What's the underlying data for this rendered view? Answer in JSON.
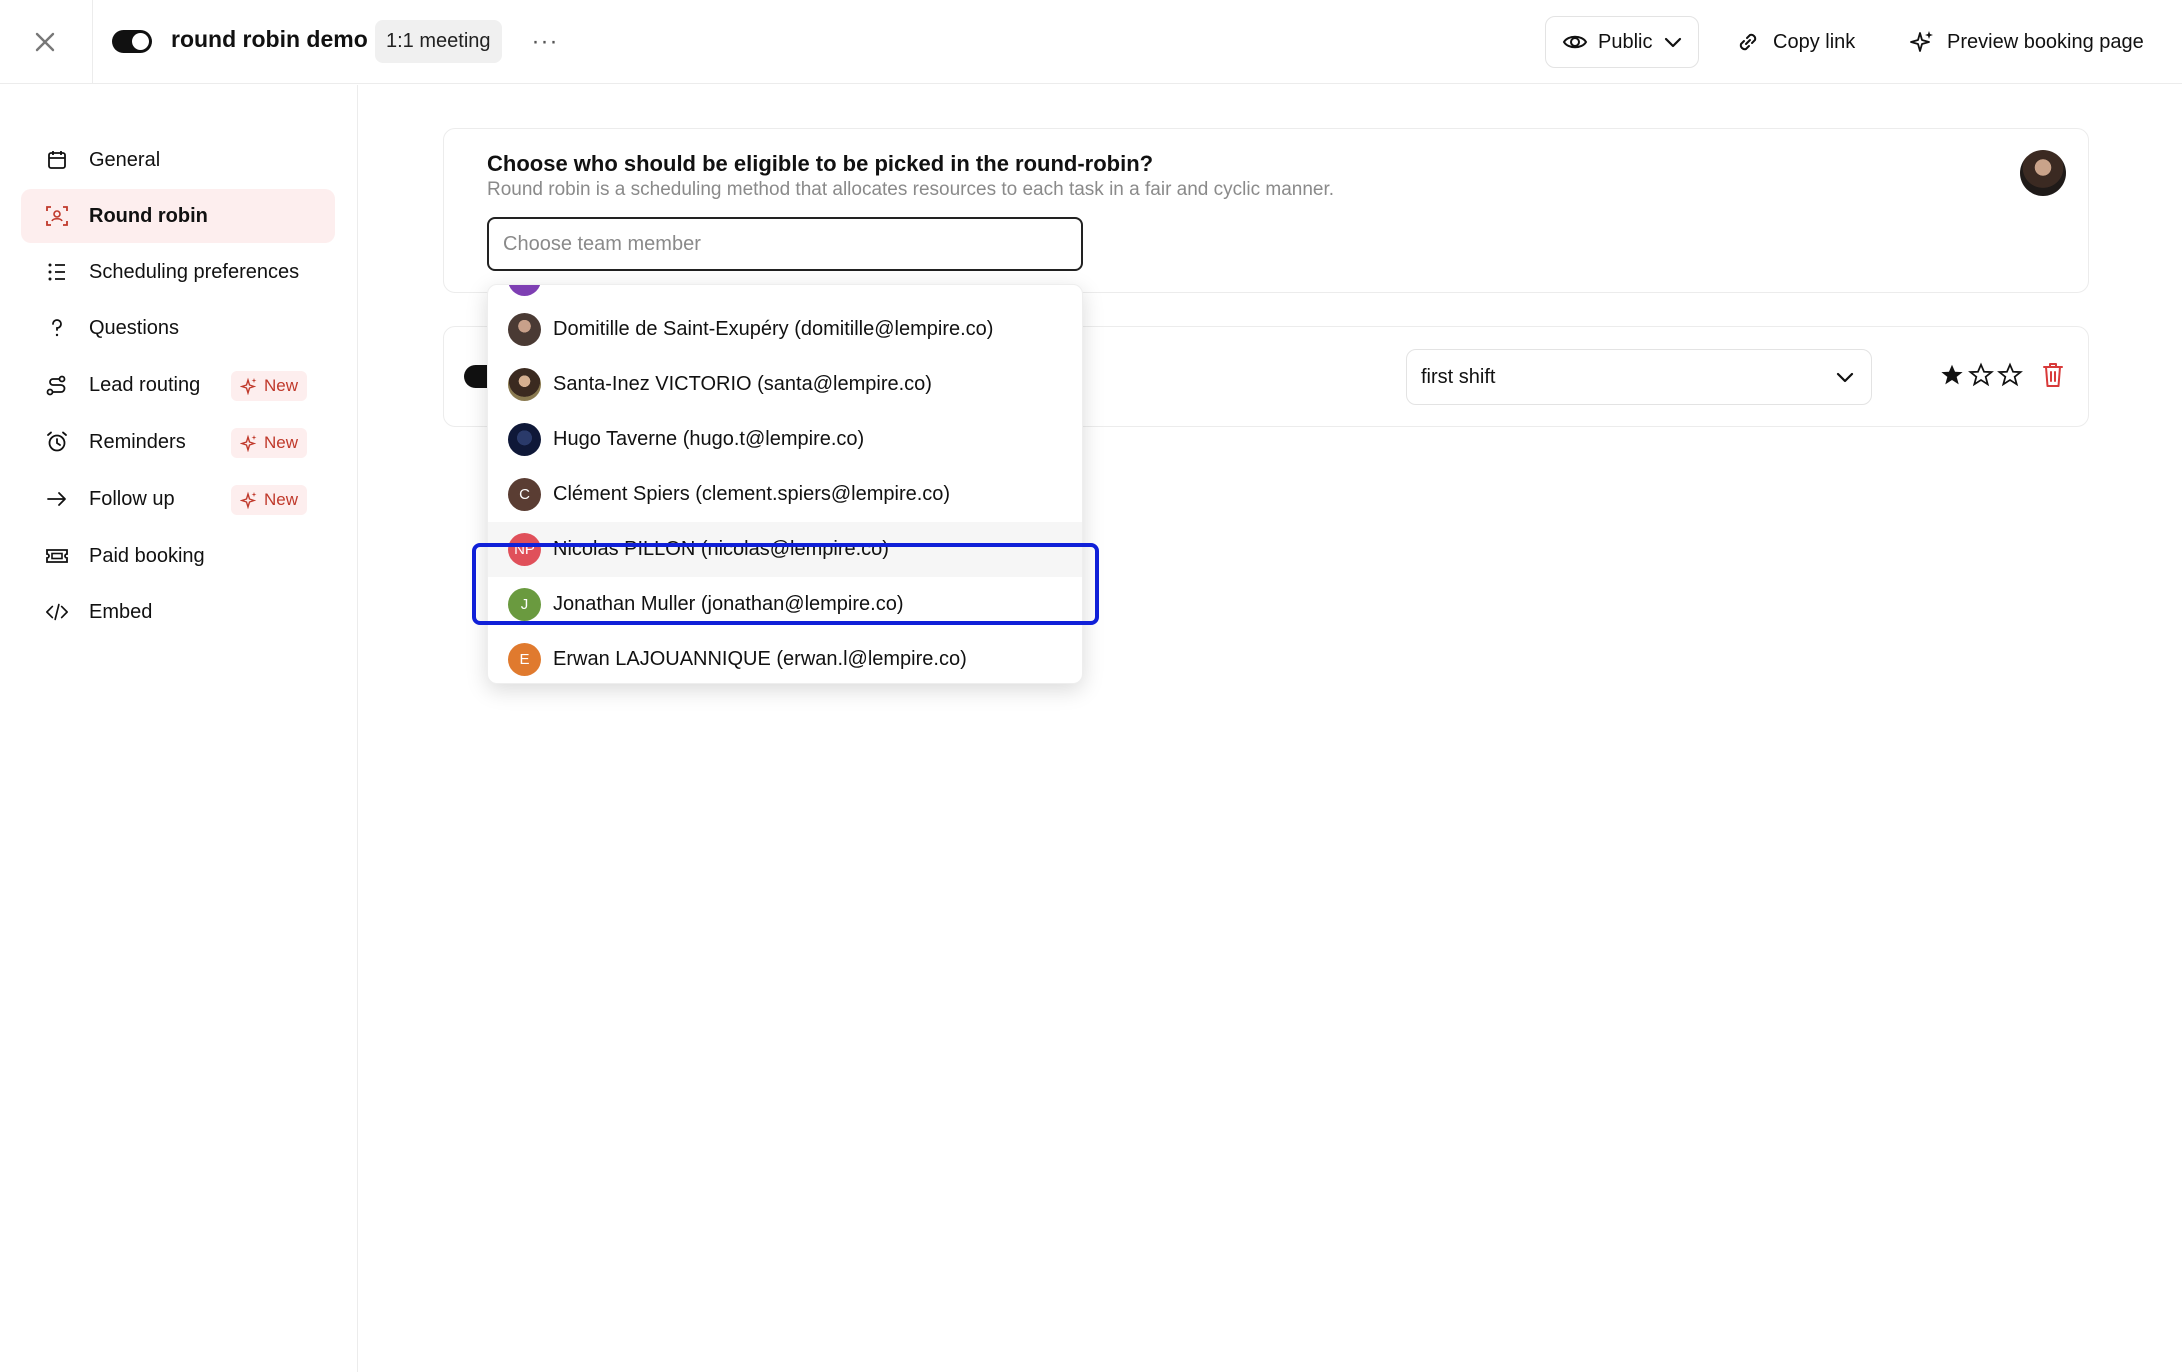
{
  "header": {
    "title": "round robin demo",
    "meeting_type": "1:1 meeting",
    "more": "···",
    "visibility": "Public",
    "copy_link": "Copy link",
    "preview": "Preview booking page"
  },
  "sidebar": {
    "items": [
      {
        "label": "General",
        "icon": "calendar-icon"
      },
      {
        "label": "Round robin",
        "icon": "round-robin-icon",
        "active": true
      },
      {
        "label": "Scheduling preferences",
        "icon": "list-icon"
      },
      {
        "label": "Questions",
        "icon": "question-icon"
      },
      {
        "label": "Lead routing",
        "icon": "route-icon",
        "badge": "New"
      },
      {
        "label": "Reminders",
        "icon": "alarm-icon",
        "badge": "New"
      },
      {
        "label": "Follow up",
        "icon": "arrow-right-icon",
        "badge": "New"
      },
      {
        "label": "Paid booking",
        "icon": "ticket-icon"
      },
      {
        "label": "Embed",
        "icon": "code-icon"
      }
    ]
  },
  "main": {
    "heading": "Choose who should be eligible to be picked in the round-robin?",
    "subheading": "Round robin is a scheduling method that allocates resources to each task in a fair and cyclic manner.",
    "search_placeholder": "Choose team member",
    "shift_value": "first shift",
    "rating": 1,
    "rating_max": 3
  },
  "dropdown": {
    "items": [
      {
        "label": "Domitille de Saint-Exupéry (domitille@lempire.co)",
        "initials": "",
        "color": "#4a3a34"
      },
      {
        "label": "Santa-Inez VICTORIO (santa@lempire.co)",
        "initials": "",
        "color": "#6b5a3a"
      },
      {
        "label": "Hugo Taverne (hugo.t@lempire.co)",
        "initials": "",
        "color": "#1c2a5a"
      },
      {
        "label": "Clément Spiers (clement.spiers@lempire.co)",
        "initials": "C",
        "color": "#5a3d33"
      },
      {
        "label": "Nicolas PILLON (nicolas@lempire.co)",
        "initials": "NP",
        "color": "#e0505a"
      },
      {
        "label": "Jonathan Muller (jonathan@lempire.co)",
        "initials": "J",
        "color": "#6a9a3f"
      },
      {
        "label": "Erwan LAJOUANNIQUE (erwan.l@lempire.co)",
        "initials": "E",
        "color": "#e07a2e"
      }
    ]
  },
  "colors": {
    "accent": "#c0392b",
    "active_bg": "#fdeeee",
    "highlight": "#1020d8"
  }
}
